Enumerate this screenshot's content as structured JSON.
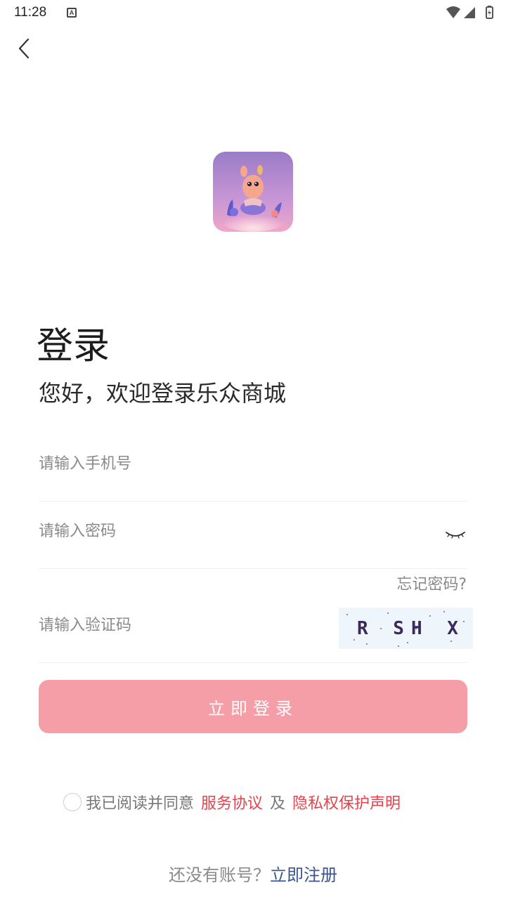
{
  "status_bar": {
    "time": "11:28",
    "notification_badge": "A"
  },
  "header": {
    "back_icon": "chevron-left-icon"
  },
  "logo": {
    "icon": "app-logo-mascot"
  },
  "title": "登录",
  "subtitle": "您好，欢迎登录乐众商城",
  "form": {
    "phone_placeholder": "请输入手机号",
    "password_placeholder": "请输入密码",
    "password_toggle_icon": "eye-closed-icon",
    "forgot_label": "忘记密码?",
    "captcha_placeholder": "请输入验证码",
    "captcha_text": "R SH X"
  },
  "login_button": "立即登录",
  "agreement": {
    "text": "我已阅读并同意",
    "service_link": "服务协议",
    "separator": "及",
    "privacy_link": "隐私权保护声明"
  },
  "register": {
    "prompt": "还没有账号？",
    "link": "立即注册"
  },
  "colors": {
    "accent": "#f69ea8",
    "link_red": "#e8414b",
    "link_blue": "#3c5591"
  }
}
